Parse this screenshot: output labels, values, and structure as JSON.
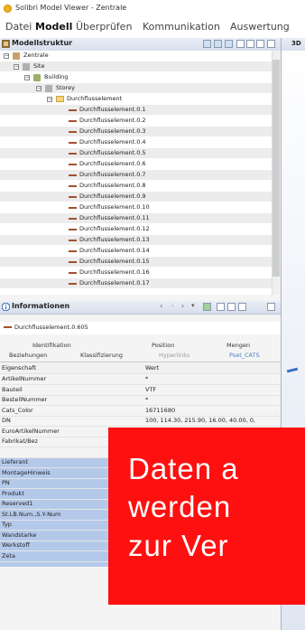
{
  "window": {
    "title": "Solibri Model Viewer - Zentrale"
  },
  "menu": [
    "Datei",
    "Modell",
    "Überprüfen",
    "Kommunikation",
    "Auswertung"
  ],
  "menu_active": "Modell",
  "model_panel": {
    "title": "Modellstruktur",
    "tree": [
      {
        "label": "Zentrale",
        "level": 0,
        "icon": "model-icon"
      },
      {
        "label": "Site",
        "level": 1,
        "icon": "site-icon"
      },
      {
        "label": "Building",
        "level": 2,
        "icon": "building-icon"
      },
      {
        "label": "Storey",
        "level": 3,
        "icon": "storey-icon"
      },
      {
        "label": "Durchflusselement",
        "level": 4,
        "icon": "folder-icon"
      },
      {
        "label": "Durchflusselement.0.1",
        "level": 5
      },
      {
        "label": "Durchflusselement.0.2",
        "level": 5
      },
      {
        "label": "Durchflusselement.0.3",
        "level": 5
      },
      {
        "label": "Durchflusselement.0.4",
        "level": 5
      },
      {
        "label": "Durchflusselement.0.5",
        "level": 5
      },
      {
        "label": "Durchflusselement.0.6",
        "level": 5
      },
      {
        "label": "Durchflusselement.0.7",
        "level": 5
      },
      {
        "label": "Durchflusselement.0.8",
        "level": 5
      },
      {
        "label": "Durchflusselement.0.9",
        "level": 5
      },
      {
        "label": "Durchflusselement.0.10",
        "level": 5
      },
      {
        "label": "Durchflusselement.0.11",
        "level": 5
      },
      {
        "label": "Durchflusselement.0.12",
        "level": 5
      },
      {
        "label": "Durchflusselement.0.13",
        "level": 5
      },
      {
        "label": "Durchflusselement.0.14",
        "level": 5
      },
      {
        "label": "Durchflusselement.0.15",
        "level": 5
      },
      {
        "label": "Durchflusselement.0.16",
        "level": 5
      },
      {
        "label": "Durchflusselement.0.17",
        "level": 5
      }
    ]
  },
  "info_panel": {
    "title": "Informationen",
    "entity": "Durchflusselement.0.605",
    "tabs_row1": [
      "Identifikation",
      "Position",
      "Mengen"
    ],
    "tabs_row2": [
      "Beziehungen",
      "Klassifizierung",
      "Hyperlinks",
      "Pset_CATS"
    ],
    "selected_tab": "Pset_CATS",
    "columns": [
      "Eigenschaft",
      "Wert"
    ],
    "properties": [
      {
        "key": "ArtikelNummer",
        "value": "*"
      },
      {
        "key": "Bauteil",
        "value": "VTF"
      },
      {
        "key": "BestellNummer",
        "value": "*"
      },
      {
        "key": "Cats_Color",
        "value": "16711680"
      },
      {
        "key": "DN",
        "value": "100, 114.30, 215.90, 16.00, 40.00, 0,"
      },
      {
        "key": "EuroArtikelNummer",
        "value": "*"
      },
      {
        "key": "Fabrikat/Bez",
        "value": ""
      },
      {
        "key": "",
        "value": ""
      },
      {
        "key": "Lieferant",
        "value": ""
      },
      {
        "key": "MontageHinweis",
        "value": ""
      },
      {
        "key": "PN",
        "value": ""
      },
      {
        "key": "Produkt",
        "value": ""
      },
      {
        "key": "Reserved1",
        "value": ""
      },
      {
        "key": "St.LB.Num.,S.Y-Num",
        "value": ""
      },
      {
        "key": "Typ",
        "value": ""
      },
      {
        "key": "Wandstarke",
        "value": ""
      },
      {
        "key": "Werkstoff",
        "value": ""
      },
      {
        "key": "Zeta",
        "value": ""
      }
    ]
  },
  "view3d": {
    "label": "3D"
  },
  "overlay": {
    "lines": [
      "Daten a",
      "werden",
      "zur Ver"
    ],
    "color": "#ff1010"
  }
}
